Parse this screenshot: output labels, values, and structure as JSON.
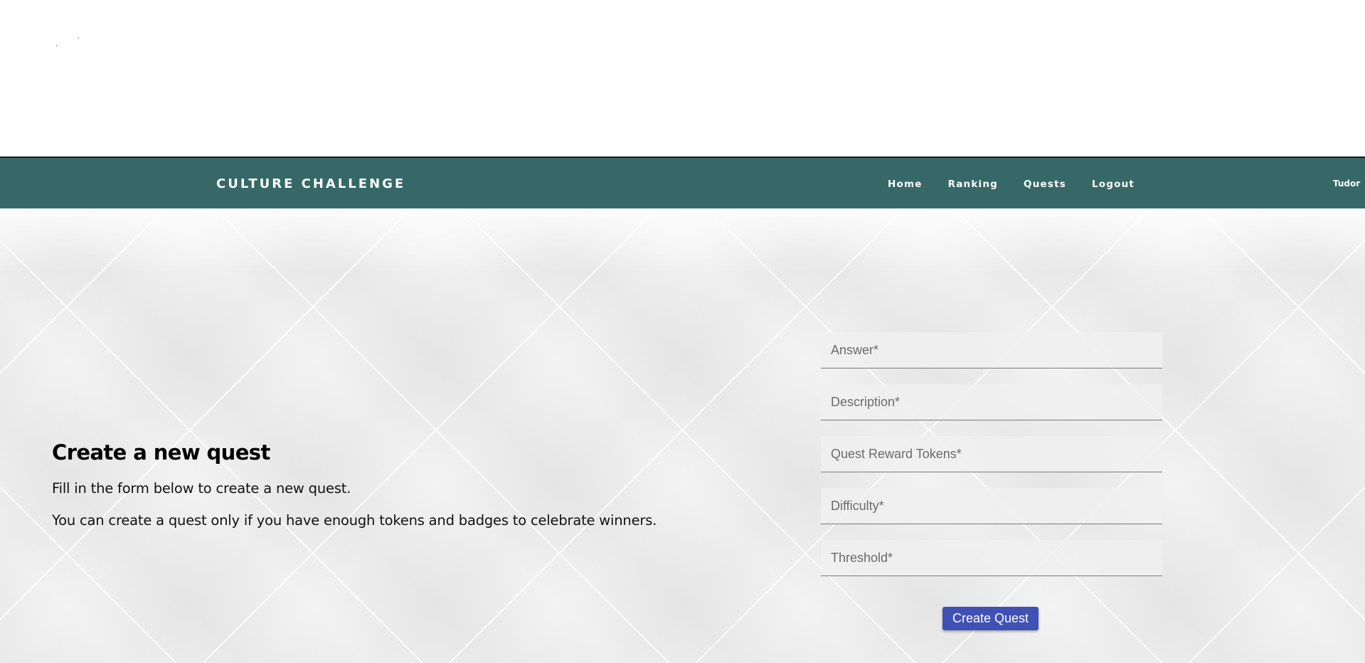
{
  "navbar": {
    "brand": "CULTURE CHALLENGE",
    "links": [
      "Home",
      "Ranking",
      "Quests",
      "Logout"
    ],
    "user": "Tudor",
    "background_color": "#356866"
  },
  "intro": {
    "title": "Create a new quest",
    "line1": "Fill in the form below to create a new quest.",
    "line2": "You can create a quest only if you have enough tokens and badges to celebrate winners."
  },
  "form": {
    "fields": [
      {
        "placeholder": "Answer*",
        "value": ""
      },
      {
        "placeholder": "Description*",
        "value": ""
      },
      {
        "placeholder": "Quest Reward Tokens*",
        "value": ""
      },
      {
        "placeholder": "Difficulty*",
        "value": ""
      },
      {
        "placeholder": "Threshold*",
        "value": ""
      }
    ],
    "submit_label": "Create Quest",
    "submit_color": "#3f51b5"
  }
}
